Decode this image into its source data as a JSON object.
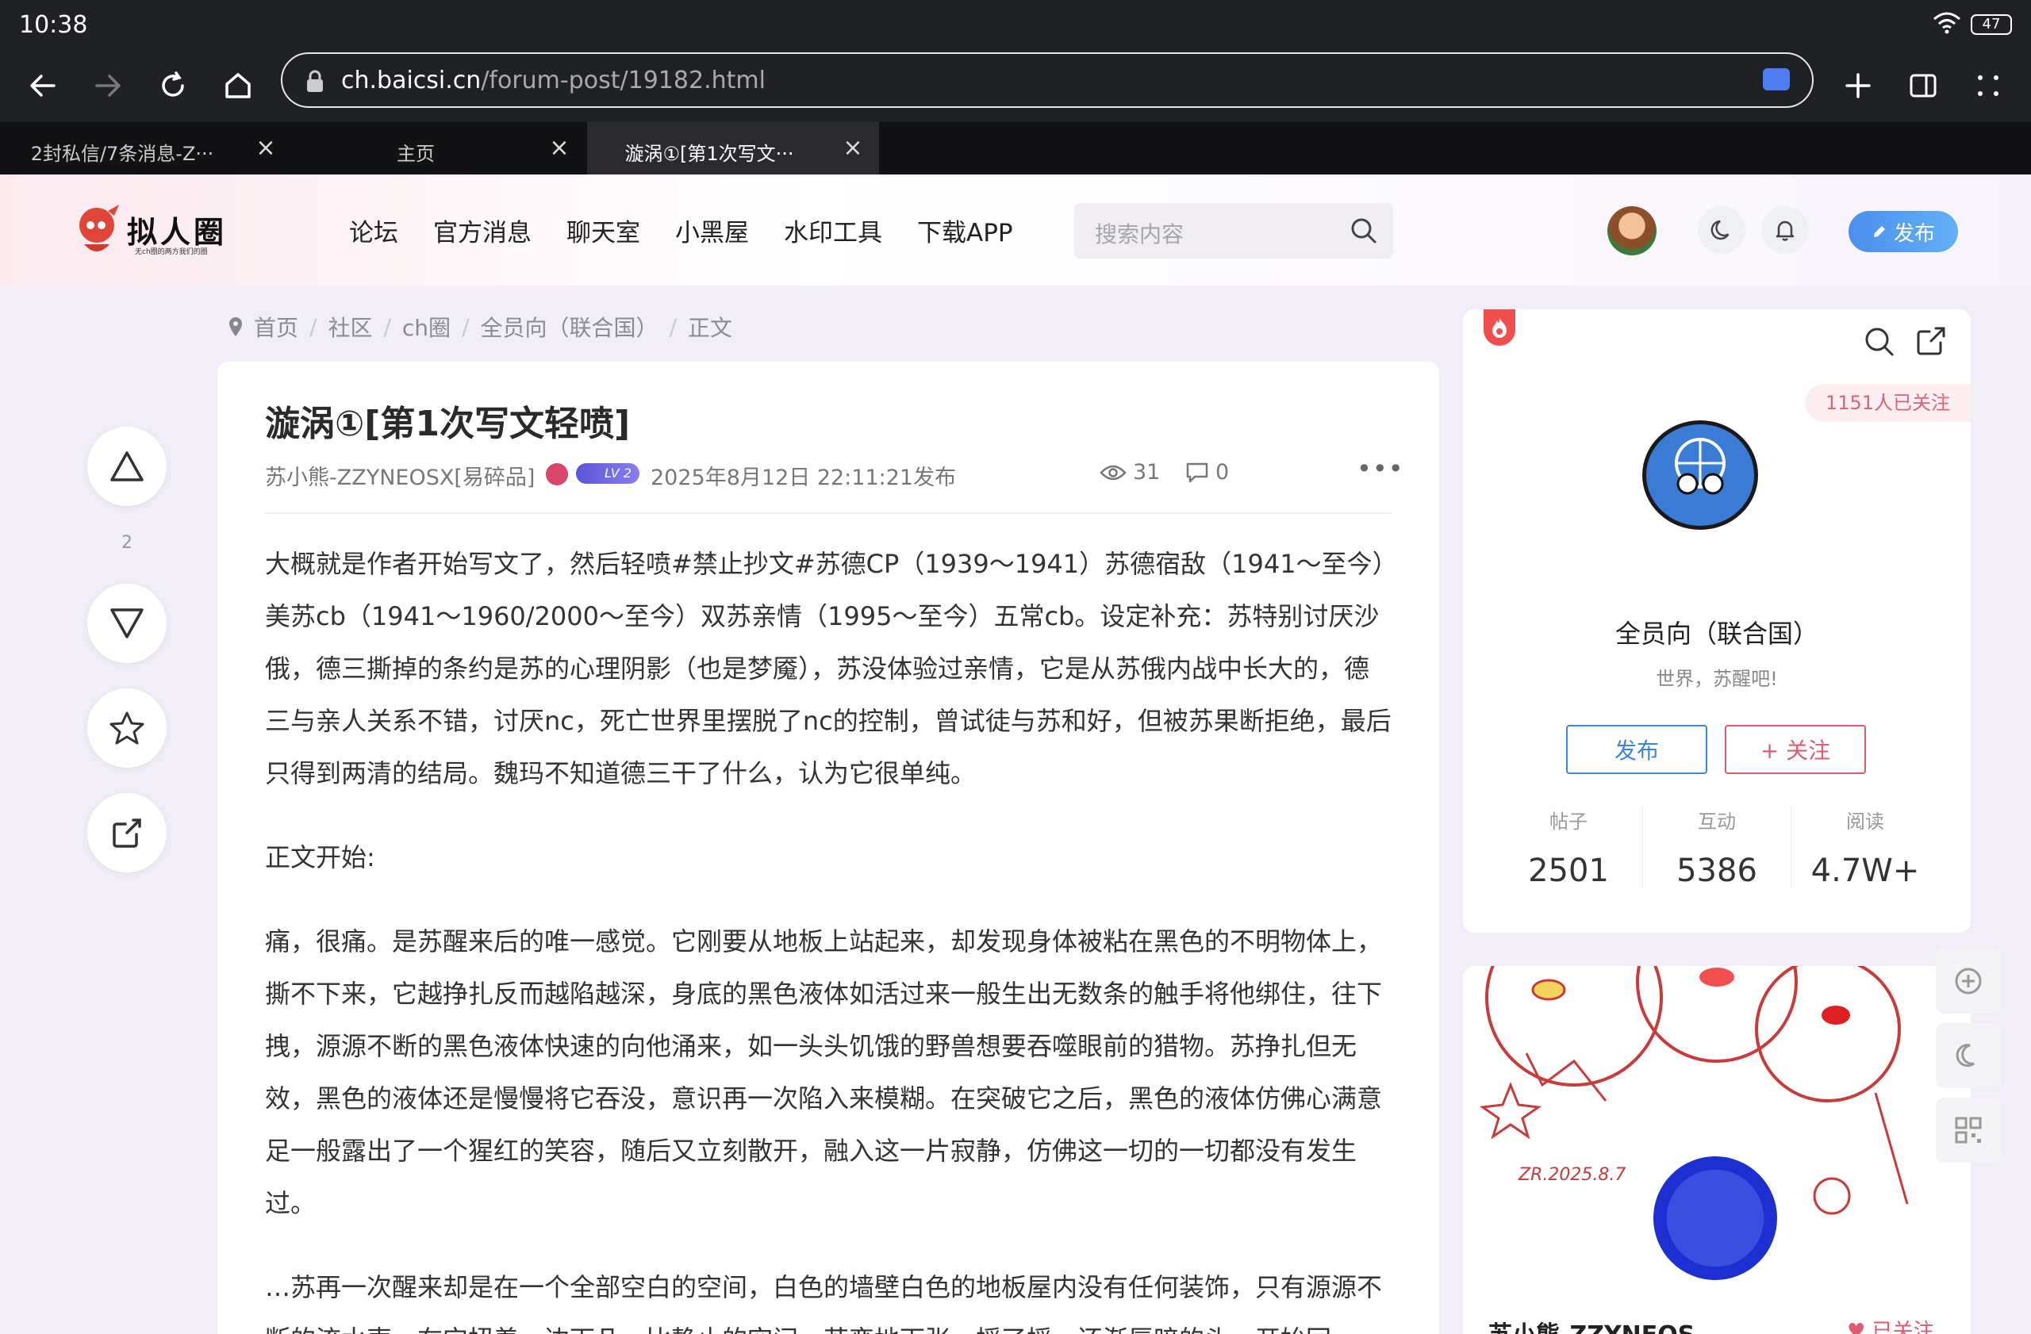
{
  "statusbar": {
    "time": "10:38",
    "battery": "47"
  },
  "browser": {
    "url_host": "ch.baicsi.cn",
    "url_path": "/forum-post/19182.html",
    "tabs": [
      {
        "label": "2封私信/7条消息-Z···",
        "active": false
      },
      {
        "label": "主页",
        "active": false
      },
      {
        "label": "漩涡①[第1次写文···",
        "active": true
      }
    ]
  },
  "site": {
    "logo_name": "拟人圈",
    "logo_tagline": "无ch圈的两方我们的圈",
    "nav": [
      "论坛",
      "官方消息",
      "聊天室",
      "小黑屋",
      "水印工具",
      "下载APP"
    ],
    "search_placeholder": "搜索内容",
    "publish_label": "发布"
  },
  "breadcrumb": [
    "首页",
    "社区",
    "ch圈",
    "全员向（联合国）",
    "正文"
  ],
  "votes": {
    "count": "2"
  },
  "post": {
    "title": "漩涡①[第1次写文轻喷]",
    "author": "苏小熊-ZZYNEOSX[易碎品]",
    "level": "LV 2",
    "date": "2025年8月12日 22:11:21发布",
    "views": "31",
    "comments": "0",
    "paragraphs": [
      "大概就是作者开始写文了，然后轻喷#禁止抄文#苏德CP（1939～1941）苏德宿敌（1941～至今）美苏cb（1941～1960/2000～至今）双苏亲情（1995～至今）五常cb。设定补充：苏特别讨厌沙俄，德三撕掉的条约是苏的心理阴影（也是梦魇），苏没体验过亲情，它是从苏俄内战中长大的，德三与亲人关系不错，讨厌nc，死亡世界里摆脱了nc的控制，曾试徒与苏和好，但被苏果断拒绝，最后只得到两清的结局。魏玛不知道德三干了什么，认为它很单纯。",
      "正文开始:",
      "痛，很痛。是苏醒来后的唯一感觉。它刚要从地板上站起来，却发现身体被粘在黑色的不明物体上，撕不下来，它越挣扎反而越陷越深，身底的黑色液体如活过来一般生出无数条的触手将他绑住，往下拽，源源不断的黑色液体快速的向他涌来，如一头头饥饿的野兽想要吞噬眼前的猎物。苏挣扎但无效，黑色的液体还是慢慢将它吞没，意识再一次陷入来模糊。在突破它之后，黑色的液体仿佛心满意足一般露出了一个猩红的笑容，随后又立刻散开，融入这一片寂静，仿佛这一切的一切都没有发生过。",
      "…苏再一次醒来却是在一个全部空白的空间，白色的墙壁白色的地板屋内没有任何装饰，只有源源不断的流水声，在它扭着一边下几，比静止的空间，苏变地下张，摇了摇，还渐唇暗的头，开始回"
    ]
  },
  "circle": {
    "followers": "1151人已关注",
    "name": "全员向（联合国）",
    "desc": "世界，苏醒吧!",
    "publish_label": "发布",
    "follow_label": "+ 关注",
    "stats": [
      {
        "label": "帖子",
        "value": "2501"
      },
      {
        "label": "互动",
        "value": "5386"
      },
      {
        "label": "阅读",
        "value": "4.7W+"
      }
    ],
    "art_signature": "ZR.2025.8.7"
  },
  "user_card": {
    "name": "苏小熊-ZZYNEOS...",
    "follow_label": "已关注"
  },
  "colors": {
    "accent_blue": "#3c86e0",
    "accent_pink": "#e05a72",
    "chrome_dark": "#202124"
  }
}
